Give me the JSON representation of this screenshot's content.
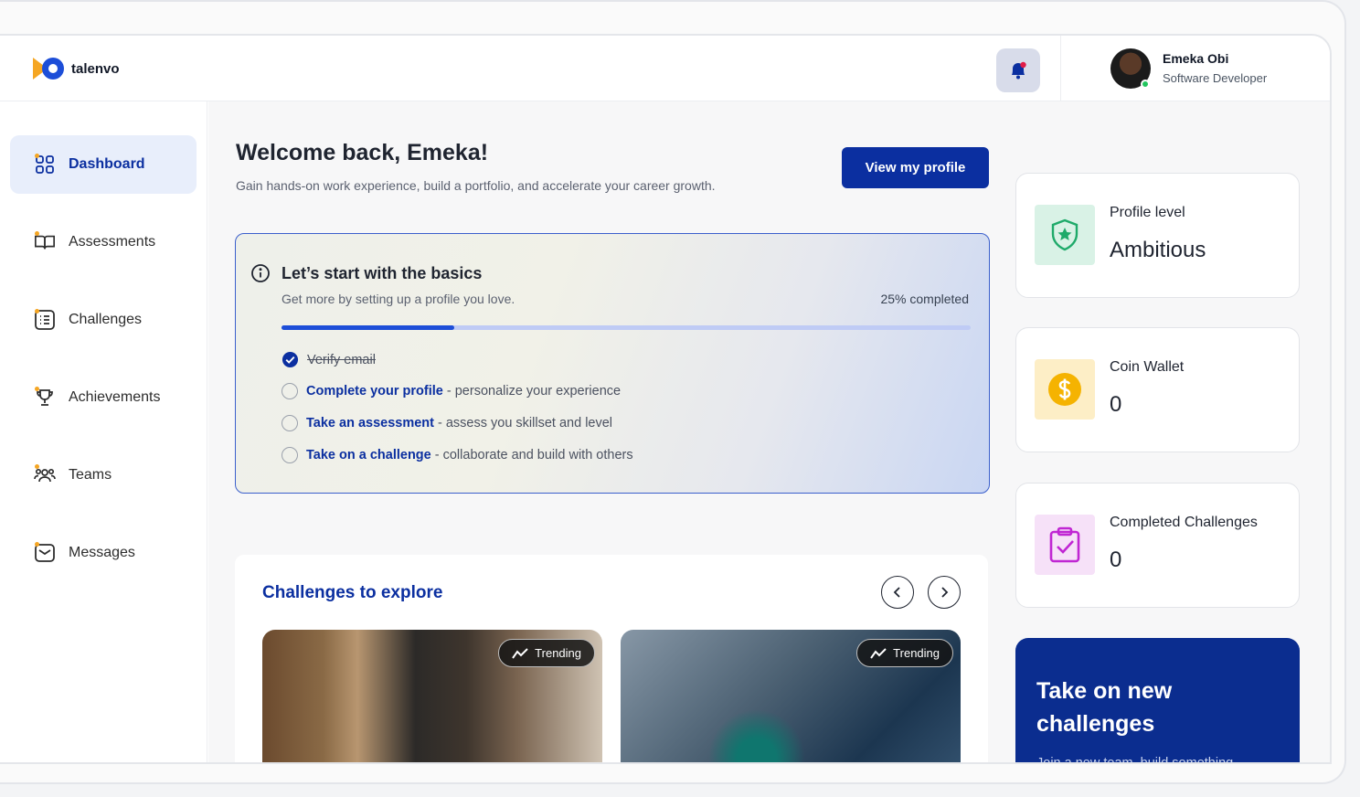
{
  "brand": {
    "name": "talenvo"
  },
  "user": {
    "name": "Emeka Obi",
    "role": "Software Developer"
  },
  "sidebar": {
    "items": [
      {
        "label": "Dashboard",
        "icon": "grid-icon",
        "active": true
      },
      {
        "label": "Assessments",
        "icon": "book-icon"
      },
      {
        "label": "Challenges",
        "icon": "list-icon"
      },
      {
        "label": "Achievements",
        "icon": "trophy-icon"
      },
      {
        "label": "Teams",
        "icon": "users-icon"
      },
      {
        "label": "Messages",
        "icon": "mail-icon"
      }
    ]
  },
  "main": {
    "welcome": "Welcome back, Emeka!",
    "subtitle": "Gain hands-on work experience, build a portfolio, and accelerate your career growth.",
    "view_profile_label": "View my profile"
  },
  "basics": {
    "title": "Let’s start with the basics",
    "subtitle": "Get more by setting up a profile you love.",
    "progress_text": "25% completed",
    "progress_value": 0.25,
    "tasks": [
      {
        "strong": "",
        "label": "Verify email",
        "done": true
      },
      {
        "strong": "Complete your profile",
        "label": " - personalize your experience",
        "done": false
      },
      {
        "strong": "Take an assessment",
        "label": " - assess you skillset and level",
        "done": false
      },
      {
        "strong": "Take on a challenge",
        "label": " - collaborate and build with others",
        "done": false
      }
    ]
  },
  "challenges": {
    "title": "Challenges to explore",
    "cards": [
      {
        "badge": "Trending"
      },
      {
        "badge": "Trending"
      }
    ]
  },
  "stats": [
    {
      "label": "Profile level",
      "value": "Ambitious",
      "icon": "shield-star-icon",
      "color": "#1faa6a",
      "bg": "#d9f2e6"
    },
    {
      "label": "Coin Wallet",
      "value": "0",
      "icon": "coin-icon",
      "color": "#f5b301",
      "bg": "#fdeec6"
    },
    {
      "label": "Completed Challenges",
      "value": "0",
      "icon": "clipboard-check-icon",
      "color": "#c026d3",
      "bg": "#f6e1f8"
    }
  ],
  "promo": {
    "title": "Take on new challenges",
    "subtitle": "Join a new team, build something amazing and upskill."
  },
  "colors": {
    "primary": "#0b2fa0",
    "accent": "#f5a623"
  }
}
